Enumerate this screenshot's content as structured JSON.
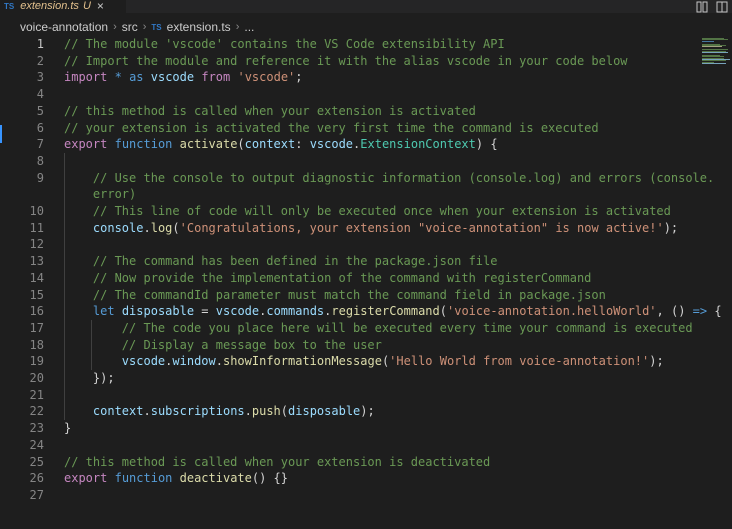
{
  "tab": {
    "lang_badge": "TS",
    "filename": "extension.ts",
    "modified_flag": "U",
    "close": "×"
  },
  "breadcrumb": {
    "folder": "voice-annotation",
    "subfolder": "src",
    "lang_badge": "TS",
    "file": "extension.ts",
    "more": "..."
  },
  "editor": {
    "lines": [
      {
        "n": "1",
        "text": "// The module 'vscode' contains the VS Code extensibility API"
      },
      {
        "n": "2",
        "text": "// Import the module and reference it with the alias vscode in your code below"
      },
      {
        "n": "3",
        "text": "import * as vscode from 'vscode';"
      },
      {
        "n": "4",
        "text": ""
      },
      {
        "n": "5",
        "text": "// this method is called when your extension is activated"
      },
      {
        "n": "6",
        "text": "// your extension is activated the very first time the command is executed"
      },
      {
        "n": "7",
        "text": "export function activate(context: vscode.ExtensionContext) {"
      },
      {
        "n": "8",
        "text": ""
      },
      {
        "n": "9",
        "text": "    // Use the console to output diagnostic information (console.log) and errors (console."
      },
      {
        "n": "",
        "text": "    error)"
      },
      {
        "n": "10",
        "text": "    // This line of code will only be executed once when your extension is activated"
      },
      {
        "n": "11",
        "text": "    console.log('Congratulations, your extension \"voice-annotation\" is now active!');"
      },
      {
        "n": "12",
        "text": ""
      },
      {
        "n": "13",
        "text": "    // The command has been defined in the package.json file"
      },
      {
        "n": "14",
        "text": "    // Now provide the implementation of the command with registerCommand"
      },
      {
        "n": "15",
        "text": "    // The commandId parameter must match the command field in package.json"
      },
      {
        "n": "16",
        "text": "    let disposable = vscode.commands.registerCommand('voice-annotation.helloWorld', () => {"
      },
      {
        "n": "17",
        "text": "        // The code you place here will be executed every time your command is executed"
      },
      {
        "n": "18",
        "text": "        // Display a message box to the user"
      },
      {
        "n": "19",
        "text": "        vscode.window.showInformationMessage('Hello World from voice-annotation!');"
      },
      {
        "n": "20",
        "text": "    });"
      },
      {
        "n": "21",
        "text": ""
      },
      {
        "n": "22",
        "text": "    context.subscriptions.push(disposable);"
      },
      {
        "n": "23",
        "text": "}"
      },
      {
        "n": "24",
        "text": ""
      },
      {
        "n": "25",
        "text": "// this method is called when your extension is deactivated"
      },
      {
        "n": "26",
        "text": "export function deactivate() {}"
      },
      {
        "n": "27",
        "text": ""
      }
    ]
  },
  "icons": {
    "compare": "compare-changes-icon",
    "split": "split-editor-icon"
  },
  "colors": {
    "background": "#1e1e1e",
    "comment": "#6a9955",
    "keyword": "#569cd6",
    "control_keyword": "#c586c0",
    "string": "#ce9178",
    "function": "#dcdcaa",
    "variable": "#9cdcfe",
    "type": "#4ec9b0",
    "modified": "#e2c08d",
    "ts_badge": "#3178c6"
  }
}
